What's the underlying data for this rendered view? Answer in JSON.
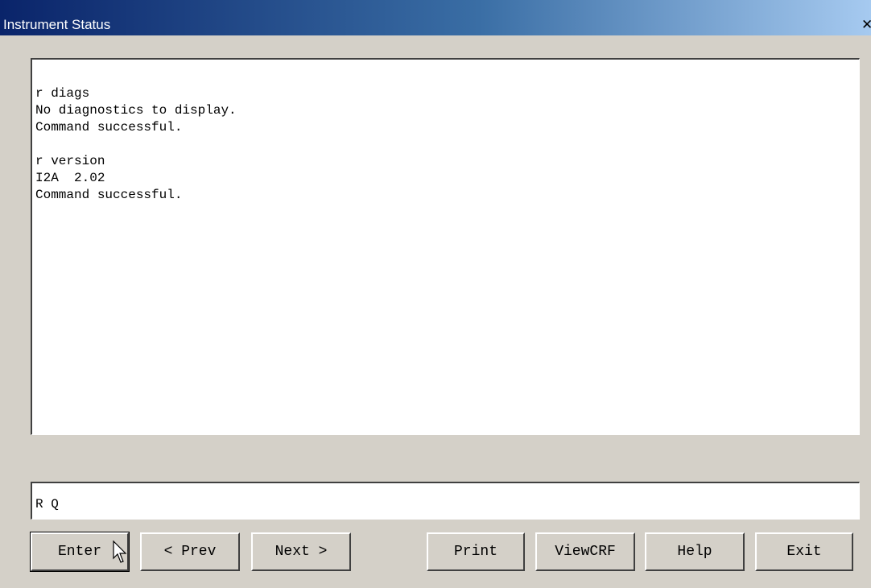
{
  "window": {
    "title": "Instrument Status",
    "close_label": "✕"
  },
  "output": {
    "text": "r diags\nNo diagnostics to display.\nCommand successful.\n\nr version\nI2A  2.02\nCommand successful."
  },
  "command": {
    "value": "R Q"
  },
  "buttons": {
    "enter": "Enter",
    "prev": "< Prev",
    "next": "Next >",
    "print": "Print",
    "viewcrf": "ViewCRF",
    "help": "Help",
    "exit": "Exit"
  }
}
